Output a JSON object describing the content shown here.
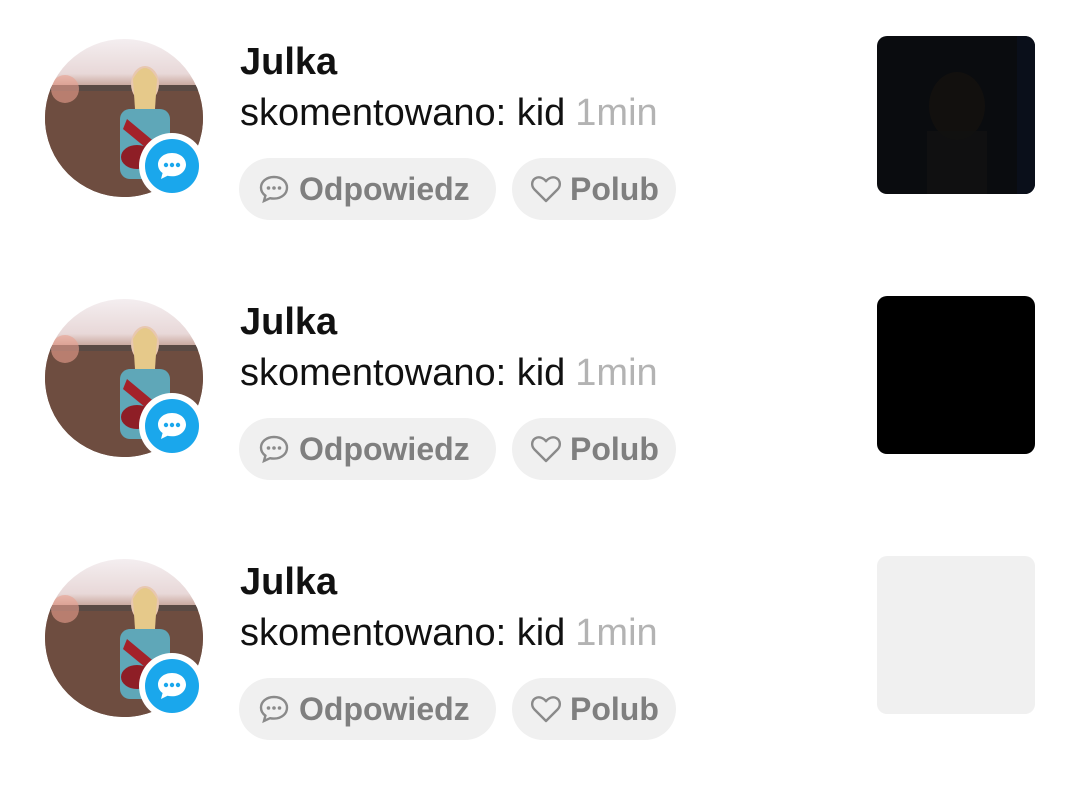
{
  "notifications": [
    {
      "username": "Julka",
      "action": "skomentowano: kid",
      "time": "1min",
      "reply_label": "Odpowiedz",
      "like_label": "Polub",
      "badge_icon": "comment-icon",
      "thumbnail_color": "#0a0c0f"
    },
    {
      "username": "Julka",
      "action": "skomentowano: kid",
      "time": "1min",
      "reply_label": "Odpowiedz",
      "like_label": "Polub",
      "badge_icon": "comment-icon",
      "thumbnail_color": "#000000"
    },
    {
      "username": "Julka",
      "action": "skomentowano: kid",
      "time": "1min",
      "reply_label": "Odpowiedz",
      "like_label": "Polub",
      "badge_icon": "comment-icon",
      "thumbnail_color": "#f0f0f0"
    }
  ],
  "colors": {
    "badge": "#1aa7ec",
    "button_bg": "#f0f0f0",
    "button_text": "#7f7f7f",
    "time_text": "#b3b3b3"
  }
}
